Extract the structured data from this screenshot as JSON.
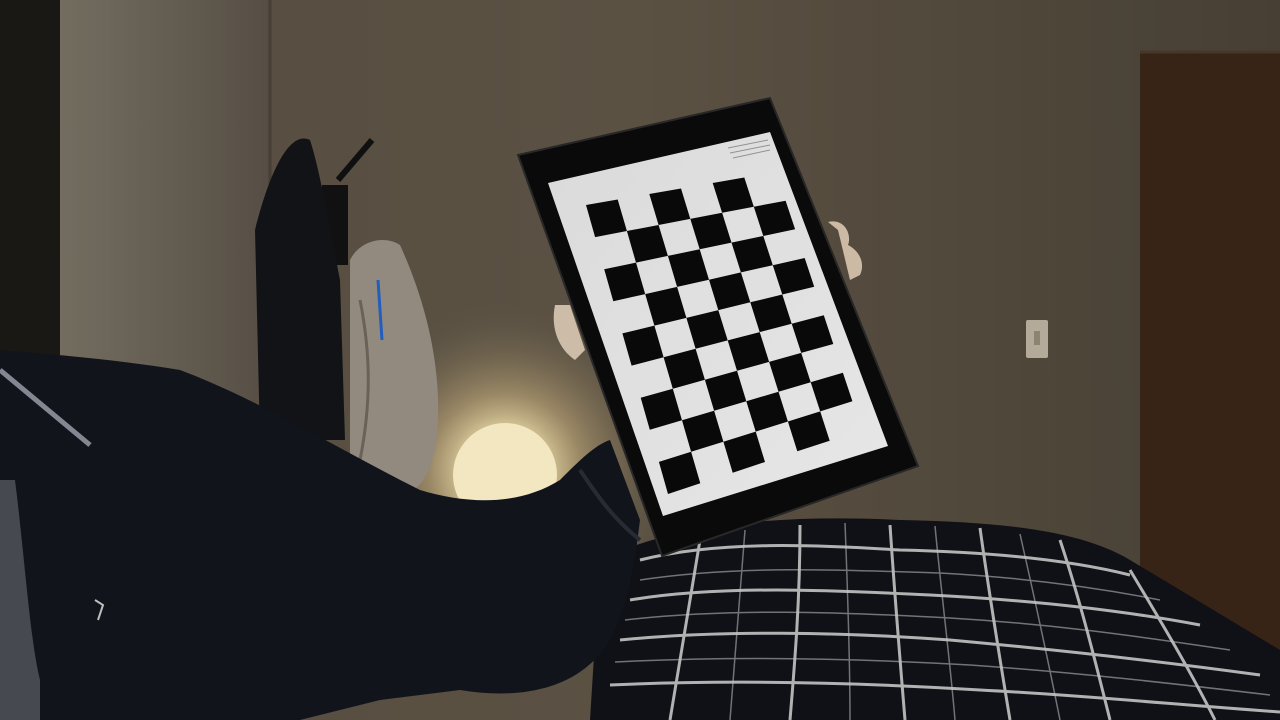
{
  "scene": {
    "description_colors": {
      "wall": "#5e5548",
      "wall_left": "#6f675b",
      "door": "#3a2619",
      "lamp_glow": "#fff2c4",
      "jacket": "#14161c",
      "tablet_bezel": "#0b0b0c",
      "screen_white": "#ececec",
      "checker_black": "#0a0a0a",
      "blanket": "#0f1016",
      "blanket_lines": "#d0d0d0"
    }
  },
  "calibration_pattern": {
    "rows": 9,
    "cols": 6
  },
  "tablet_note": {
    "lines": [
      "",
      "",
      ""
    ]
  }
}
